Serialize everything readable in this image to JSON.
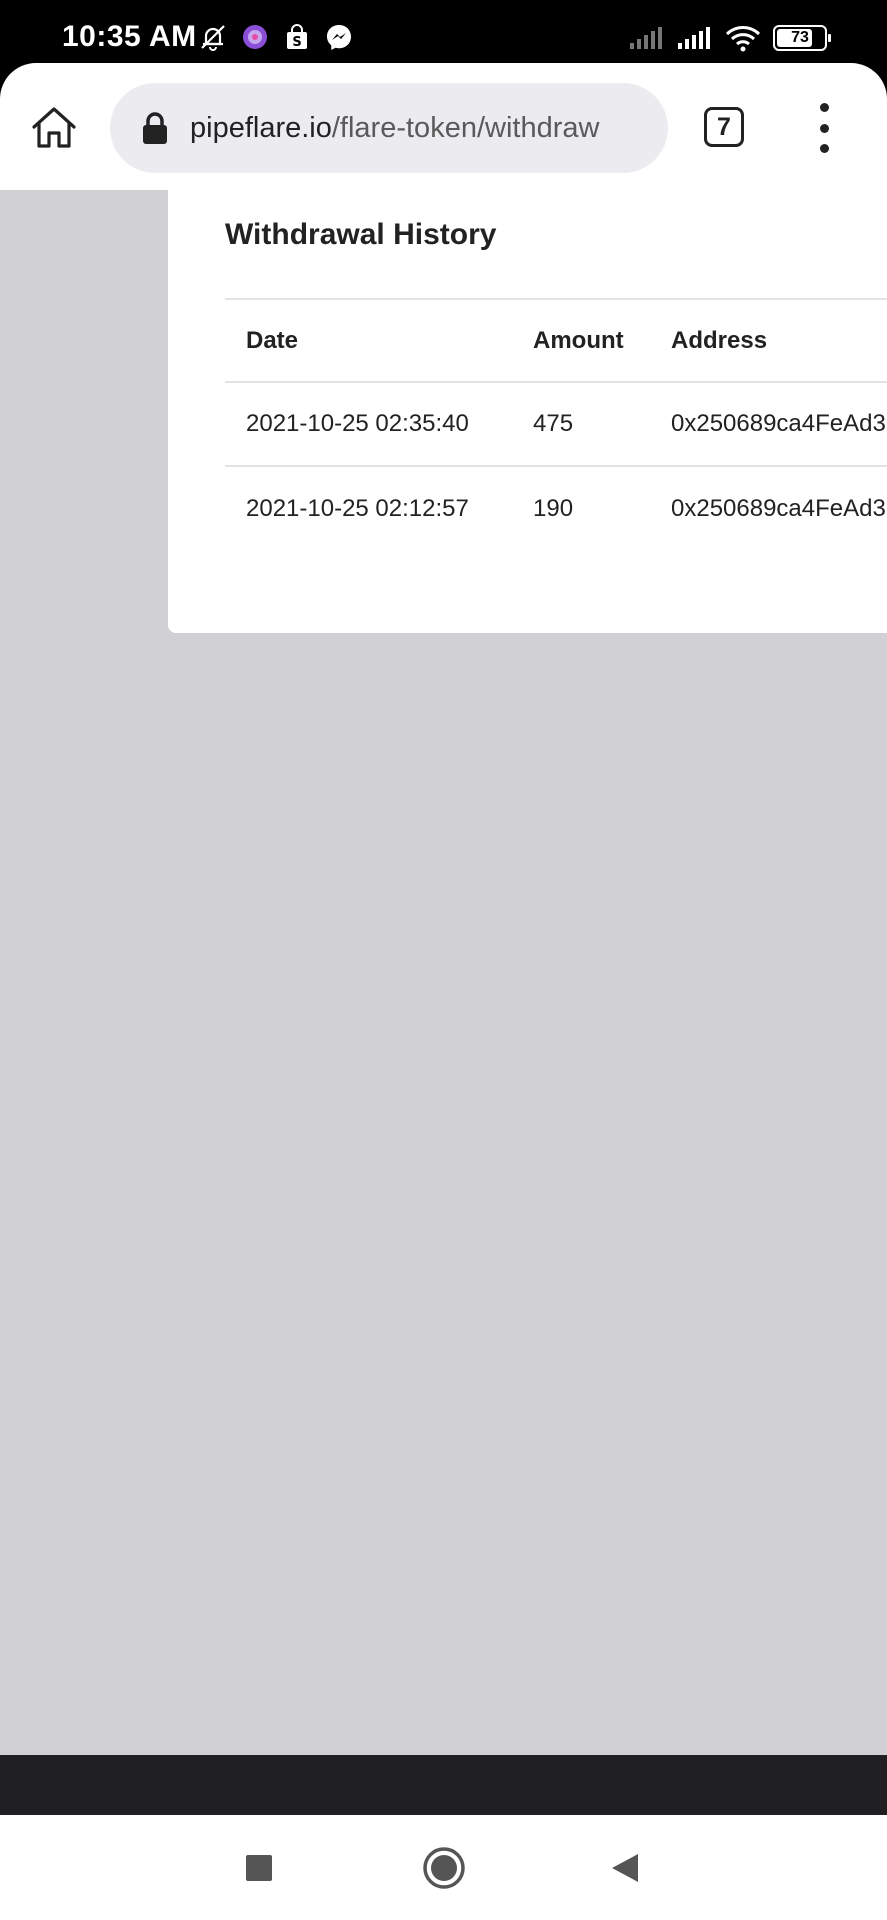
{
  "status_bar": {
    "time": "10:35 AM",
    "battery": "73",
    "icons": [
      "notifications-off-icon",
      "app-notification-icon",
      "shopping-bag-icon",
      "messenger-icon",
      "signal-icon",
      "signal-icon",
      "wifi-icon",
      "battery-icon"
    ]
  },
  "browser": {
    "url_host": "pipeflare.io",
    "url_path": "/flare-token/withdraw",
    "tab_count": "7"
  },
  "page": {
    "title": "Withdrawal History",
    "columns": [
      "Date",
      "Amount",
      "Address"
    ],
    "rows": [
      {
        "date": "2021-10-25 02:35:40",
        "amount": "475",
        "address": "0x250689ca4FeAd3"
      },
      {
        "date": "2021-10-25 02:12:57",
        "amount": "190",
        "address": "0x250689ca4FeAd3"
      }
    ]
  },
  "colors": {
    "page_background": "#d1d0d5",
    "card_background": "#ffffff",
    "url_bar": "#ececf0"
  }
}
